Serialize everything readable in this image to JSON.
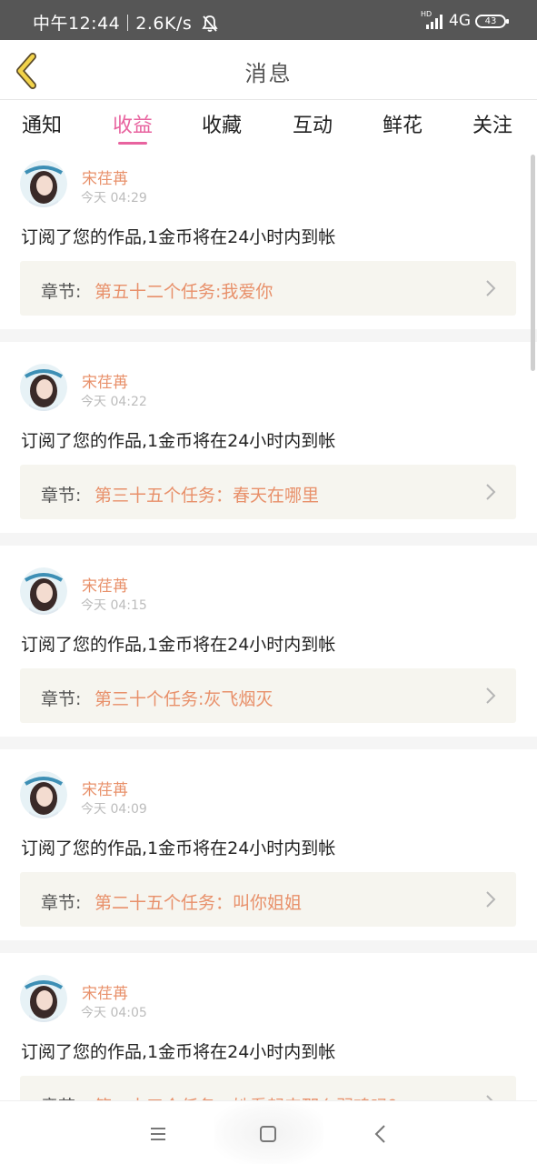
{
  "status_bar": {
    "time": "中午12:44",
    "speed": "2.6K/s",
    "network": "4G",
    "hd": "HD",
    "battery": "43"
  },
  "header": {
    "title": "消息",
    "back_icon": "chevron-left-icon"
  },
  "tabs": [
    {
      "label": "通知",
      "active": false
    },
    {
      "label": "收益",
      "active": true
    },
    {
      "label": "收藏",
      "active": false
    },
    {
      "label": "互动",
      "active": false
    },
    {
      "label": "鲜花",
      "active": false
    },
    {
      "label": "关注",
      "active": false
    }
  ],
  "accent_color": "#e8639f",
  "name_color": "#e8906a",
  "messages": [
    {
      "user": "宋荏苒",
      "time": "今天 04:29",
      "text": "订阅了您的作品,1金币将在24小时内到帐",
      "chapter_label": "章节:",
      "chapter_title": "第五十二个任务:我爱你"
    },
    {
      "user": "宋荏苒",
      "time": "今天 04:22",
      "text": "订阅了您的作品,1金币将在24小时内到帐",
      "chapter_label": "章节:",
      "chapter_title": "第三十五个任务：春天在哪里"
    },
    {
      "user": "宋荏苒",
      "time": "今天 04:15",
      "text": "订阅了您的作品,1金币将在24小时内到帐",
      "chapter_label": "章节:",
      "chapter_title": "第三十个任务:灰飞烟灭"
    },
    {
      "user": "宋荏苒",
      "time": "今天 04:09",
      "text": "订阅了您的作品,1金币将在24小时内到帐",
      "chapter_label": "章节:",
      "chapter_title": "第二十五个任务：叫你姐姐"
    },
    {
      "user": "宋荏苒",
      "time": "今天 04:05",
      "text": "订阅了您的作品,1金币将在24小时内到帐",
      "chapter_label": "章节:",
      "chapter_title": "第二十三个任务：她看起来那么弱鸡吗？"
    }
  ],
  "nav": {
    "menu_icon": "menu-icon",
    "home_icon": "home-square-icon",
    "back_icon": "back-triangle-icon"
  }
}
